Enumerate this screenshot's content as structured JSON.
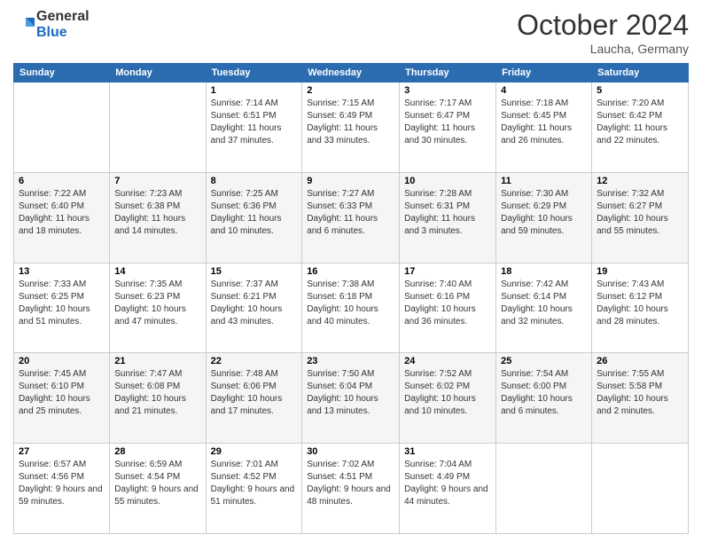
{
  "header": {
    "logo_general": "General",
    "logo_blue": "Blue",
    "month_title": "October 2024",
    "location": "Laucha, Germany"
  },
  "weekdays": [
    "Sunday",
    "Monday",
    "Tuesday",
    "Wednesday",
    "Thursday",
    "Friday",
    "Saturday"
  ],
  "weeks": [
    [
      {
        "day": "",
        "info": ""
      },
      {
        "day": "",
        "info": ""
      },
      {
        "day": "1",
        "info": "Sunrise: 7:14 AM\nSunset: 6:51 PM\nDaylight: 11 hours and 37 minutes."
      },
      {
        "day": "2",
        "info": "Sunrise: 7:15 AM\nSunset: 6:49 PM\nDaylight: 11 hours and 33 minutes."
      },
      {
        "day": "3",
        "info": "Sunrise: 7:17 AM\nSunset: 6:47 PM\nDaylight: 11 hours and 30 minutes."
      },
      {
        "day": "4",
        "info": "Sunrise: 7:18 AM\nSunset: 6:45 PM\nDaylight: 11 hours and 26 minutes."
      },
      {
        "day": "5",
        "info": "Sunrise: 7:20 AM\nSunset: 6:42 PM\nDaylight: 11 hours and 22 minutes."
      }
    ],
    [
      {
        "day": "6",
        "info": "Sunrise: 7:22 AM\nSunset: 6:40 PM\nDaylight: 11 hours and 18 minutes."
      },
      {
        "day": "7",
        "info": "Sunrise: 7:23 AM\nSunset: 6:38 PM\nDaylight: 11 hours and 14 minutes."
      },
      {
        "day": "8",
        "info": "Sunrise: 7:25 AM\nSunset: 6:36 PM\nDaylight: 11 hours and 10 minutes."
      },
      {
        "day": "9",
        "info": "Sunrise: 7:27 AM\nSunset: 6:33 PM\nDaylight: 11 hours and 6 minutes."
      },
      {
        "day": "10",
        "info": "Sunrise: 7:28 AM\nSunset: 6:31 PM\nDaylight: 11 hours and 3 minutes."
      },
      {
        "day": "11",
        "info": "Sunrise: 7:30 AM\nSunset: 6:29 PM\nDaylight: 10 hours and 59 minutes."
      },
      {
        "day": "12",
        "info": "Sunrise: 7:32 AM\nSunset: 6:27 PM\nDaylight: 10 hours and 55 minutes."
      }
    ],
    [
      {
        "day": "13",
        "info": "Sunrise: 7:33 AM\nSunset: 6:25 PM\nDaylight: 10 hours and 51 minutes."
      },
      {
        "day": "14",
        "info": "Sunrise: 7:35 AM\nSunset: 6:23 PM\nDaylight: 10 hours and 47 minutes."
      },
      {
        "day": "15",
        "info": "Sunrise: 7:37 AM\nSunset: 6:21 PM\nDaylight: 10 hours and 43 minutes."
      },
      {
        "day": "16",
        "info": "Sunrise: 7:38 AM\nSunset: 6:18 PM\nDaylight: 10 hours and 40 minutes."
      },
      {
        "day": "17",
        "info": "Sunrise: 7:40 AM\nSunset: 6:16 PM\nDaylight: 10 hours and 36 minutes."
      },
      {
        "day": "18",
        "info": "Sunrise: 7:42 AM\nSunset: 6:14 PM\nDaylight: 10 hours and 32 minutes."
      },
      {
        "day": "19",
        "info": "Sunrise: 7:43 AM\nSunset: 6:12 PM\nDaylight: 10 hours and 28 minutes."
      }
    ],
    [
      {
        "day": "20",
        "info": "Sunrise: 7:45 AM\nSunset: 6:10 PM\nDaylight: 10 hours and 25 minutes."
      },
      {
        "day": "21",
        "info": "Sunrise: 7:47 AM\nSunset: 6:08 PM\nDaylight: 10 hours and 21 minutes."
      },
      {
        "day": "22",
        "info": "Sunrise: 7:48 AM\nSunset: 6:06 PM\nDaylight: 10 hours and 17 minutes."
      },
      {
        "day": "23",
        "info": "Sunrise: 7:50 AM\nSunset: 6:04 PM\nDaylight: 10 hours and 13 minutes."
      },
      {
        "day": "24",
        "info": "Sunrise: 7:52 AM\nSunset: 6:02 PM\nDaylight: 10 hours and 10 minutes."
      },
      {
        "day": "25",
        "info": "Sunrise: 7:54 AM\nSunset: 6:00 PM\nDaylight: 10 hours and 6 minutes."
      },
      {
        "day": "26",
        "info": "Sunrise: 7:55 AM\nSunset: 5:58 PM\nDaylight: 10 hours and 2 minutes."
      }
    ],
    [
      {
        "day": "27",
        "info": "Sunrise: 6:57 AM\nSunset: 4:56 PM\nDaylight: 9 hours and 59 minutes."
      },
      {
        "day": "28",
        "info": "Sunrise: 6:59 AM\nSunset: 4:54 PM\nDaylight: 9 hours and 55 minutes."
      },
      {
        "day": "29",
        "info": "Sunrise: 7:01 AM\nSunset: 4:52 PM\nDaylight: 9 hours and 51 minutes."
      },
      {
        "day": "30",
        "info": "Sunrise: 7:02 AM\nSunset: 4:51 PM\nDaylight: 9 hours and 48 minutes."
      },
      {
        "day": "31",
        "info": "Sunrise: 7:04 AM\nSunset: 4:49 PM\nDaylight: 9 hours and 44 minutes."
      },
      {
        "day": "",
        "info": ""
      },
      {
        "day": "",
        "info": ""
      }
    ]
  ]
}
